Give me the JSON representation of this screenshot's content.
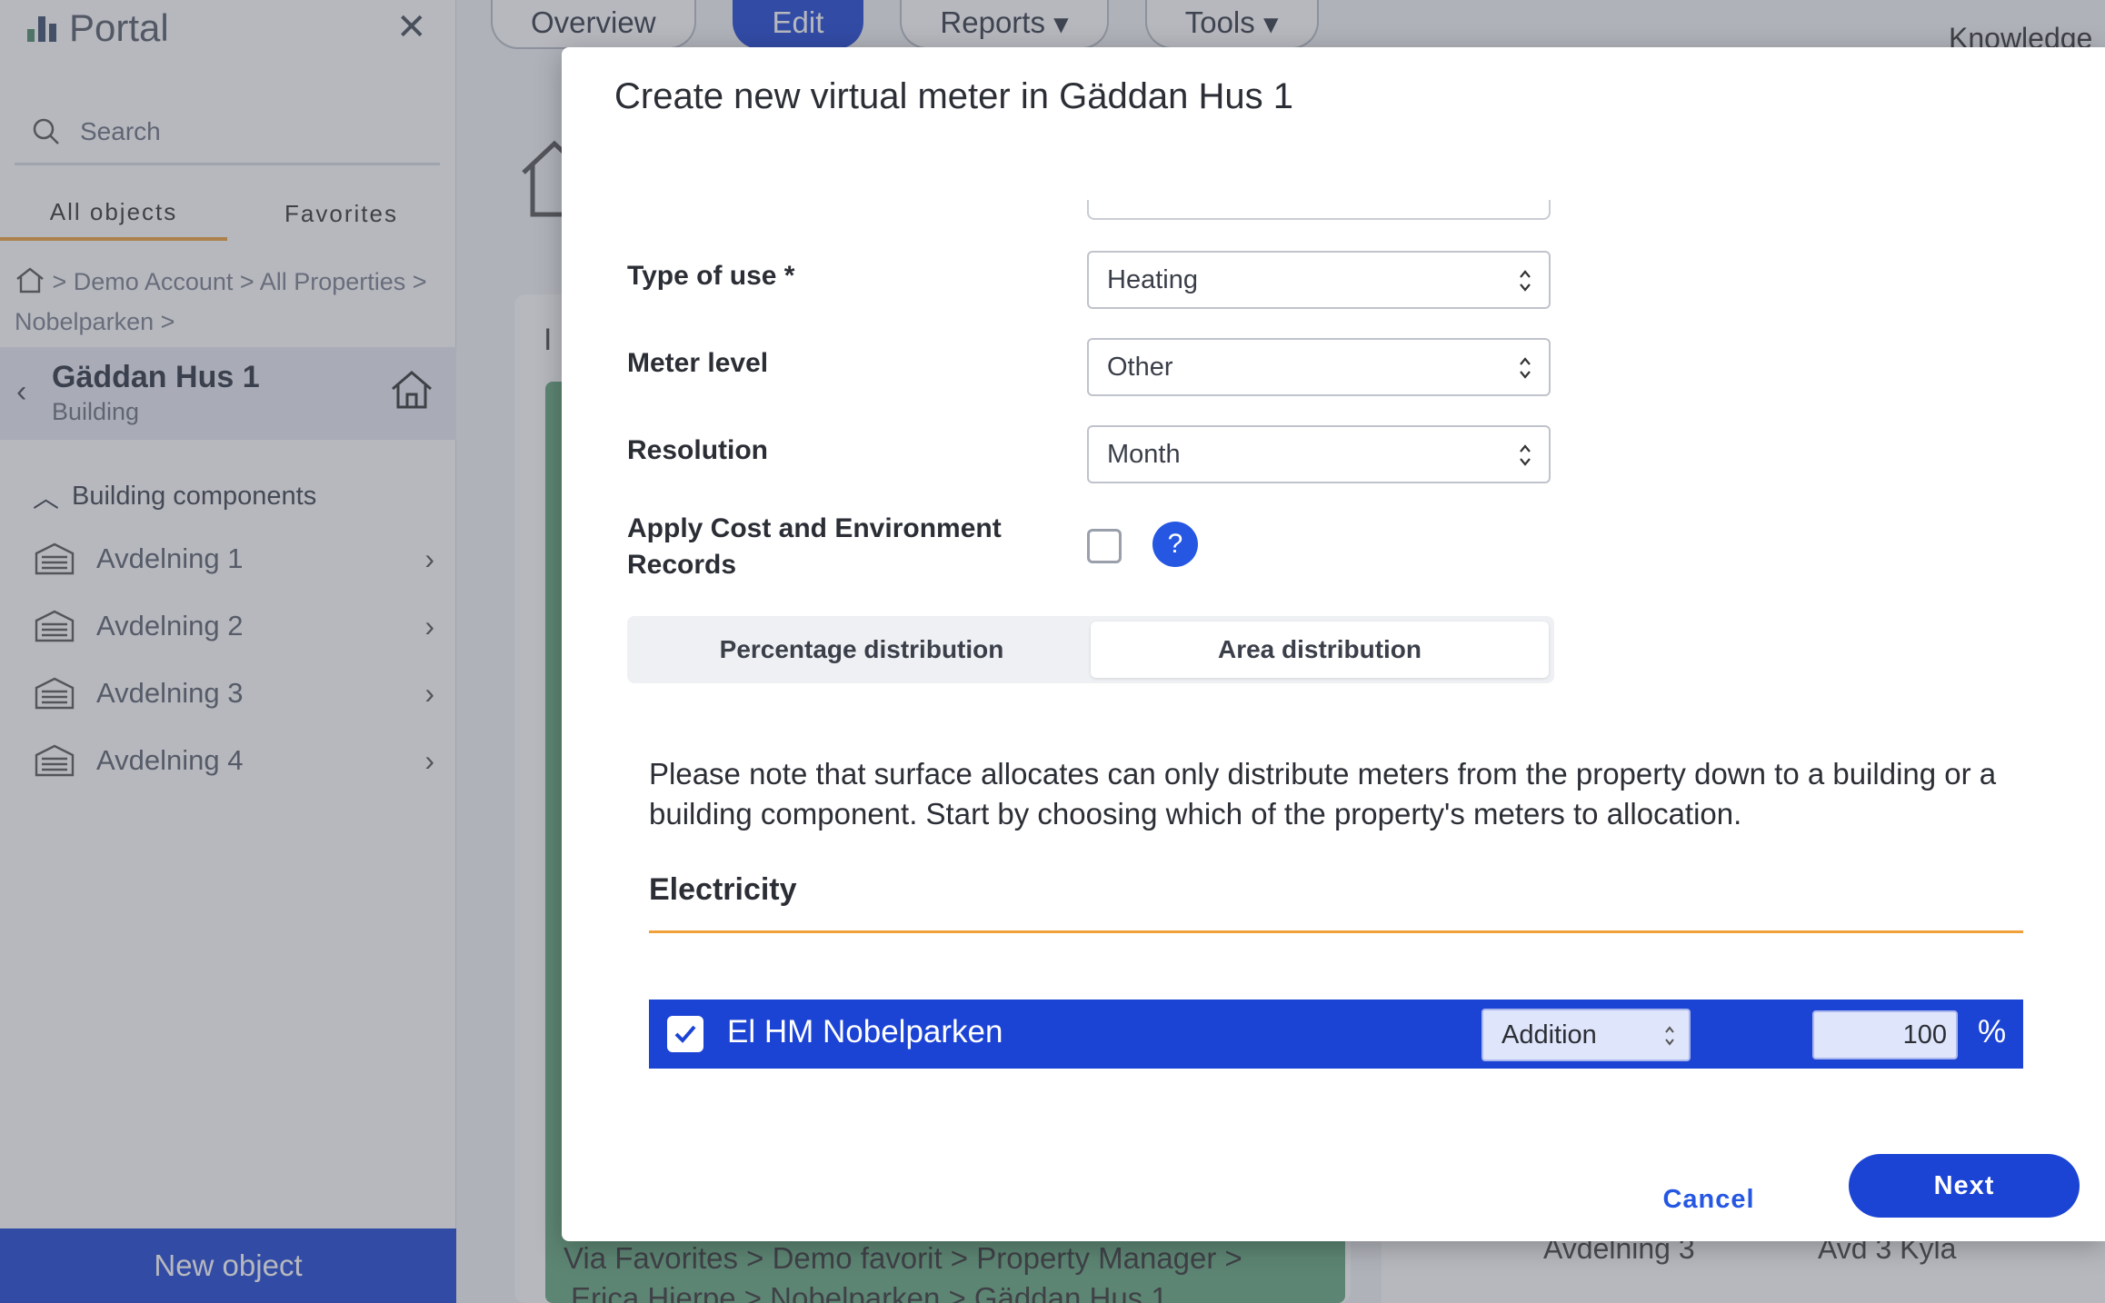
{
  "app": {
    "brand": "Portal",
    "search_placeholder": "Search",
    "tabs": [
      "All objects",
      "Favorites"
    ],
    "breadcrumb": [
      "Demo Account",
      "All Properties",
      "Nobelparken"
    ],
    "selected": {
      "title": "Gäddan Hus 1",
      "subtitle": "Building"
    },
    "components_heading": "Building components",
    "components": [
      "Avdelning 1",
      "Avdelning 2",
      "Avdelning 3",
      "Avdelning 4"
    ],
    "new_object": "New object",
    "nav": [
      "Overview",
      "Edit",
      "Reports",
      "Tools"
    ],
    "nav_active": "Edit",
    "knowledge": "Knowledge",
    "bg_letter": "I",
    "bg_footer_line1": "Via Favorites  >  Demo favorit  >  Property Manager  >",
    "bg_footer_line2": "Erica Hjerpe  >  Nobelparken  >  Gäddan Hus 1",
    "bg_right": [
      "Avdelning 3",
      "Avd 3 Kyla"
    ]
  },
  "modal": {
    "title": "Create new virtual meter in Gäddan Hus 1",
    "fields": {
      "type_of_use": {
        "label": "Type of use *",
        "value": "Heating"
      },
      "meter_level": {
        "label": "Meter level",
        "value": "Other"
      },
      "resolution": {
        "label": "Resolution",
        "value": "Month"
      },
      "apply_cost": {
        "label": "Apply Cost and Environment Records",
        "checked": false,
        "help": "?"
      }
    },
    "segments": {
      "left": "Percentage distribution",
      "right": "Area distribution",
      "active": "right"
    },
    "note": "Please note that surface allocates can only distribute meters from the property down to a building or a building component. Start by choosing which of the property's meters to allocation.",
    "section": "Electricity",
    "meter": {
      "name": "El HM Nobelparken",
      "checked": true,
      "operation": "Addition",
      "value": "100",
      "unit": "%"
    },
    "cancel": "Cancel",
    "next": "Next"
  },
  "colors": {
    "accent": "#1c44d4",
    "tab_underline": "#f0a13a",
    "help": "#2557e3"
  }
}
